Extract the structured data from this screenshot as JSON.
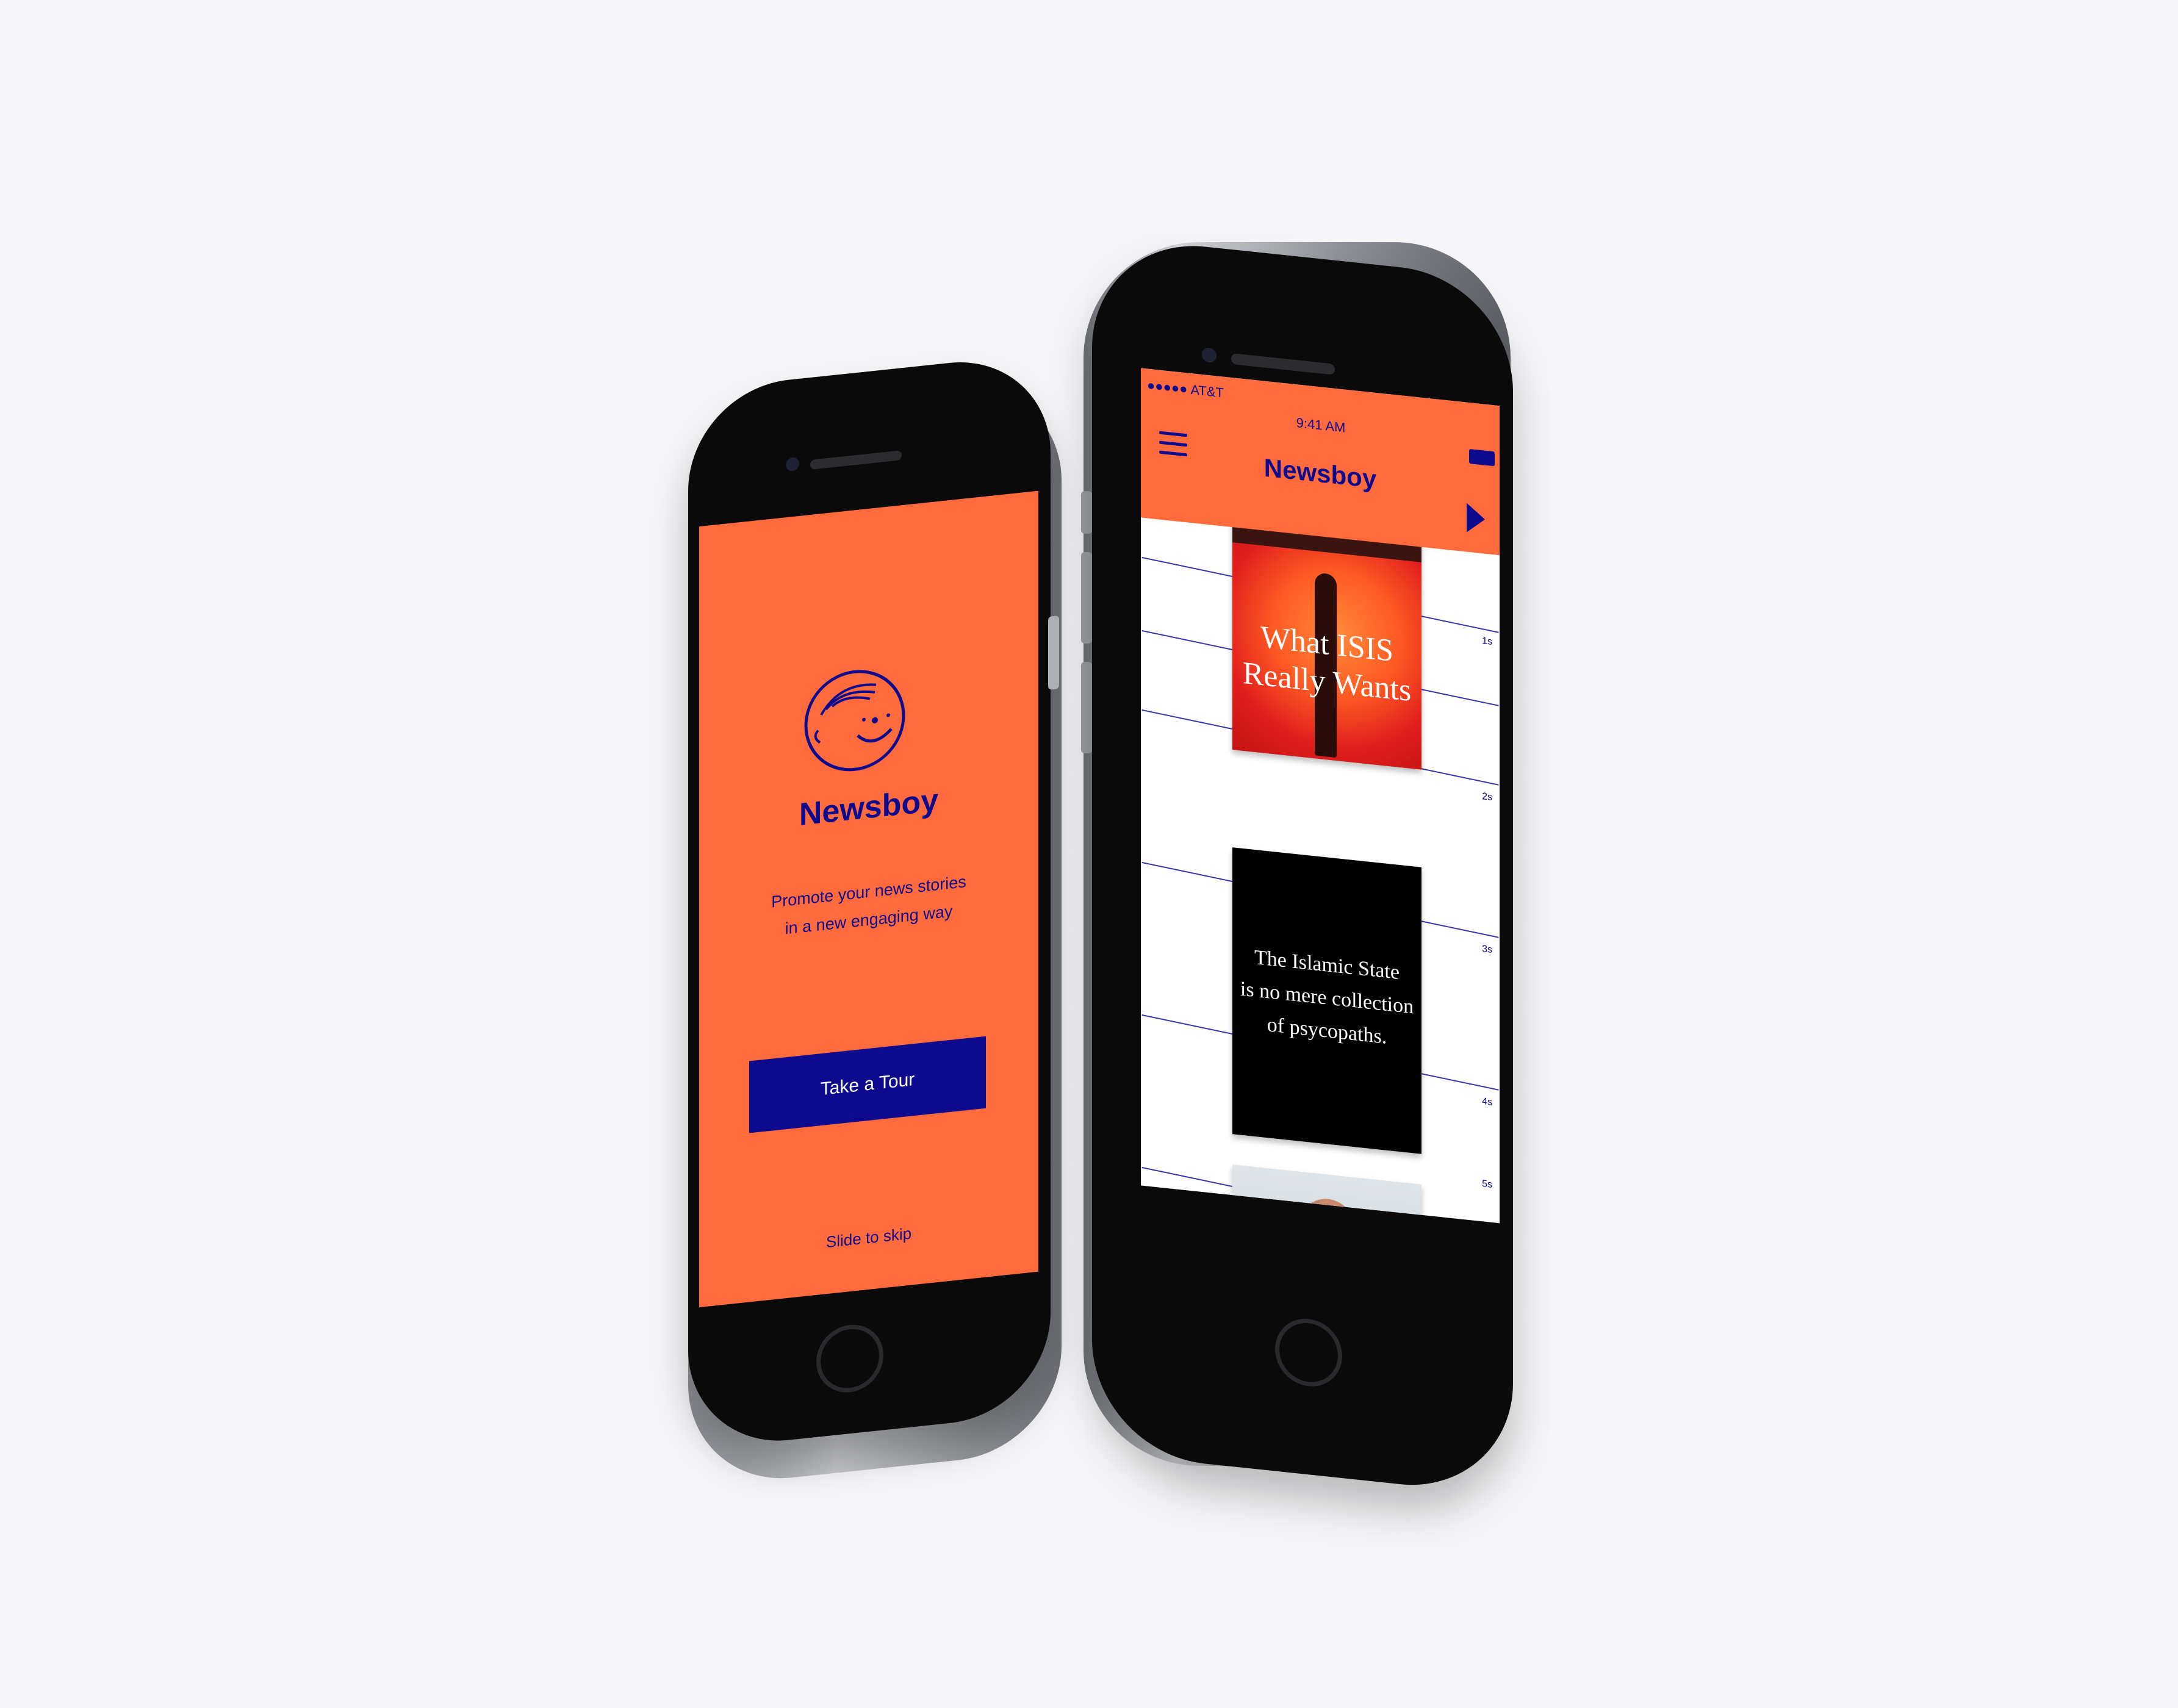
{
  "colors": {
    "accent_orange": "#ff6b3d",
    "brand_blue": "#0d0a8e",
    "background": "#f6f6f8"
  },
  "intro_screen": {
    "logo_icon": "newsboy-face-icon",
    "app_name": "Newsboy",
    "tagline_line1": "Promote your news stories",
    "tagline_line2": "in a new engaging way",
    "tour_button": "Take a Tour",
    "skip_hint": "Slide to skip"
  },
  "feed_screen": {
    "status_bar": {
      "carrier": "●●●●● AT&T",
      "time": "9:41 AM"
    },
    "menu_icon": "hamburger-menu-icon",
    "app_title": "Newsboy",
    "play_icon": "play-icon",
    "timeline_labels": [
      "1s",
      "2s",
      "3s",
      "4s",
      "5s"
    ],
    "cards": [
      {
        "text_line1": "What ISIS",
        "text_line2": "Really Wants"
      },
      {
        "text_line1": "The Islamic State",
        "text_line2": "is no mere collection",
        "text_line3": "of psycopaths."
      },
      {
        "image": "portrait-photo"
      }
    ]
  }
}
